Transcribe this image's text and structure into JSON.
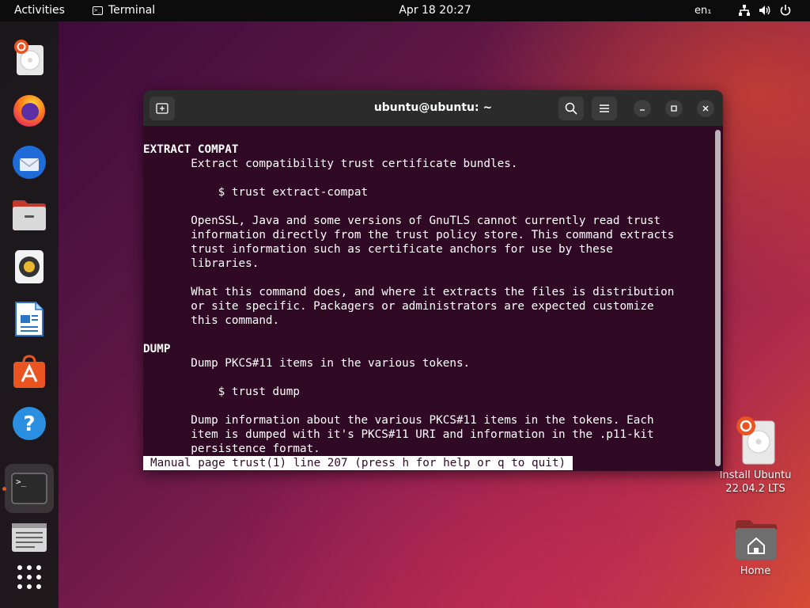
{
  "topbar": {
    "activities": "Activities",
    "app_name": "Terminal",
    "clock": "Apr 18  20:27",
    "language": "en₁",
    "icons": [
      "network-icon",
      "volume-icon",
      "power-icon"
    ]
  },
  "dock": {
    "items": [
      {
        "name": "installer",
        "icon": "ubuntu-installer-icon"
      },
      {
        "name": "firefox",
        "icon": "firefox-icon"
      },
      {
        "name": "thunderbird",
        "icon": "thunderbird-icon"
      },
      {
        "name": "files",
        "icon": "files-icon"
      },
      {
        "name": "rhythmbox",
        "icon": "rhythmbox-icon"
      },
      {
        "name": "writer",
        "icon": "libreoffice-writer-icon"
      },
      {
        "name": "software",
        "icon": "ubuntu-software-icon"
      },
      {
        "name": "help",
        "icon": "help-icon"
      },
      {
        "name": "terminal",
        "icon": "terminal-icon",
        "running": true
      },
      {
        "name": "text-editor",
        "icon": "text-editor-icon"
      },
      {
        "name": "show-apps",
        "icon": "app-grid-icon"
      }
    ]
  },
  "desktop": {
    "install_label_1": "Install Ubuntu",
    "install_label_2": "22.04.2 LTS",
    "home_label": "Home"
  },
  "terminal": {
    "title": "ubuntu@ubuntu: ~",
    "lines": [
      {
        "text": "EXTRACT COMPAT",
        "bold": true
      },
      {
        "text": "       Extract compatibility trust certificate bundles.",
        "bold": false
      },
      {
        "text": "",
        "bold": false
      },
      {
        "text": "           $ trust extract-compat",
        "bold": false
      },
      {
        "text": "",
        "bold": false
      },
      {
        "text": "       OpenSSL, Java and some versions of GnuTLS cannot currently read trust",
        "bold": false
      },
      {
        "text": "       information directly from the trust policy store. This command extracts",
        "bold": false
      },
      {
        "text": "       trust information such as certificate anchors for use by these",
        "bold": false
      },
      {
        "text": "       libraries.",
        "bold": false
      },
      {
        "text": "",
        "bold": false
      },
      {
        "text": "       What this command does, and where it extracts the files is distribution",
        "bold": false
      },
      {
        "text": "       or site specific. Packagers or administrators are expected customize",
        "bold": false
      },
      {
        "text": "       this command.",
        "bold": false
      },
      {
        "text": "",
        "bold": false
      },
      {
        "text": "DUMP",
        "bold": true
      },
      {
        "text": "       Dump PKCS#11 items in the various tokens.",
        "bold": false
      },
      {
        "text": "",
        "bold": false
      },
      {
        "text": "           $ trust dump",
        "bold": false
      },
      {
        "text": "",
        "bold": false
      },
      {
        "text": "       Dump information about the various PKCS#11 items in the tokens. Each",
        "bold": false
      },
      {
        "text": "       item is dumped with it's PKCS#11 URI and information in the .p11-kit",
        "bold": false
      },
      {
        "text": "       persistence format.",
        "bold": false
      }
    ],
    "status": "Manual page trust(1) line 207 (press h for help or q to quit)"
  }
}
